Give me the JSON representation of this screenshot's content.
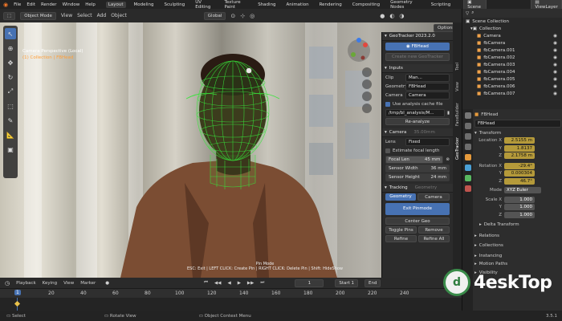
{
  "menu": {
    "items": [
      "File",
      "Edit",
      "Render",
      "Window",
      "Help"
    ],
    "workspaces": [
      "Layout",
      "Modeling",
      "Sculpting",
      "UV Editing",
      "Texture Paint",
      "Shading",
      "Animation",
      "Rendering",
      "Compositing",
      "Geometry Nodes",
      "Scripting"
    ],
    "active_workspace": "Layout",
    "scene": "Scene",
    "view_layer": "ViewLayer"
  },
  "viewport_header": {
    "mode": "Object Mode",
    "menus": [
      "View",
      "Select",
      "Add",
      "Object"
    ],
    "orientation": "Global",
    "options": "Options"
  },
  "viewport": {
    "camera_label": "Camera Perspective (Local)",
    "camera_sub": "(1) Collection | FBHead",
    "pin_title": "Pin Mode",
    "pin_hint": "ESC: Exit | LEFT CLICK: Create Pin | RIGHT CLICK: Delete Pin | Shift: HideShow"
  },
  "geotracker": {
    "title": "GeoTracker 2023.2.0",
    "tracker_name": "FBHead",
    "create_btn": "Create new GeoTracker",
    "inputs_label": "Inputs",
    "clip_label": "Clip",
    "clip_value": "Man...",
    "geometry_label": "Geometry",
    "geometry_value": "FBHead",
    "camera_label": "Camera",
    "camera_value": "Camera",
    "cache_label": "Use analysis cache file",
    "cache_path": "/tmp/bl_analysis/M...",
    "analyze_btn": "Re-analyze",
    "camera_section": "Camera",
    "camera_section_extra": "35.00mm",
    "lens_label": "Lens",
    "lens_value": "Fixed",
    "estimate_label": "Estimate focal length",
    "focal_label": "Focal Len",
    "focal_value": "45 mm",
    "sensor_w_label": "Sensor Width",
    "sensor_w_value": "36 mm",
    "sensor_h_label": "Sensor Height",
    "sensor_h_value": "24 mm",
    "tracking_section": "Tracking",
    "tracking_extra": "Geometry",
    "mode_geometry": "Geometry",
    "mode_camera": "Camera",
    "exit_pin": "Exit Pinmode",
    "center_geo": "Center Geo",
    "toggle_pins": "Toggle Pins",
    "remove_pins": "Remove",
    "refine": "Refine",
    "refine_all": "Refine All"
  },
  "side_tabs": [
    "Tool",
    "View",
    "FaceBuilder",
    "GeoTracker"
  ],
  "outliner": {
    "root": "Scene Collection",
    "collection": "Collection",
    "items": [
      "Camera",
      "fbCamera",
      "fbCamera.001",
      "fbCamera.002",
      "fbCamera.003",
      "fbCamera.004",
      "fbCamera.005",
      "fbCamera.006",
      "fbCamera.007"
    ]
  },
  "properties": {
    "object_name": "FBHead",
    "object_field": "FBHead",
    "transform_label": "Transform",
    "location_label": "Location X",
    "location": [
      "2.5155 m",
      "1.8137",
      "2.1758 m"
    ],
    "rotation_label": "Rotation X",
    "rotation": [
      "-29.4°",
      "0.000304",
      "46.7°"
    ],
    "mode_label": "Mode",
    "mode_value": "XYZ Euler",
    "scale_label": "Scale X",
    "scale": [
      "1.000",
      "1.000",
      "1.000"
    ],
    "axis_y": "Y",
    "axis_z": "Z",
    "delta_label": "Delta Transform",
    "relations_label": "Relations",
    "collections_label": "Collections",
    "instancing_label": "Instancing",
    "motion_label": "Motion Paths",
    "visibility_label": "Visibility"
  },
  "timeline": {
    "menus": [
      "Playback",
      "Keying",
      "View",
      "Marker"
    ],
    "current_frame": "1",
    "start_label": "Start",
    "start_value": "1",
    "end_label": "End",
    "ruler_ticks": [
      "1",
      "20",
      "40",
      "60",
      "80",
      "100",
      "120",
      "140",
      "160",
      "180",
      "200",
      "220",
      "240"
    ]
  },
  "statusbar": {
    "items": [
      "Select",
      "Rotate View",
      "Object Context Menu"
    ],
    "version": "3.5.1"
  },
  "watermark": {
    "text": "4eskTop",
    "icon_glyph": "d"
  },
  "colors": {
    "accent": "#4772b3",
    "wireframe": "#37e53a",
    "orange": "#ff9f3a"
  }
}
